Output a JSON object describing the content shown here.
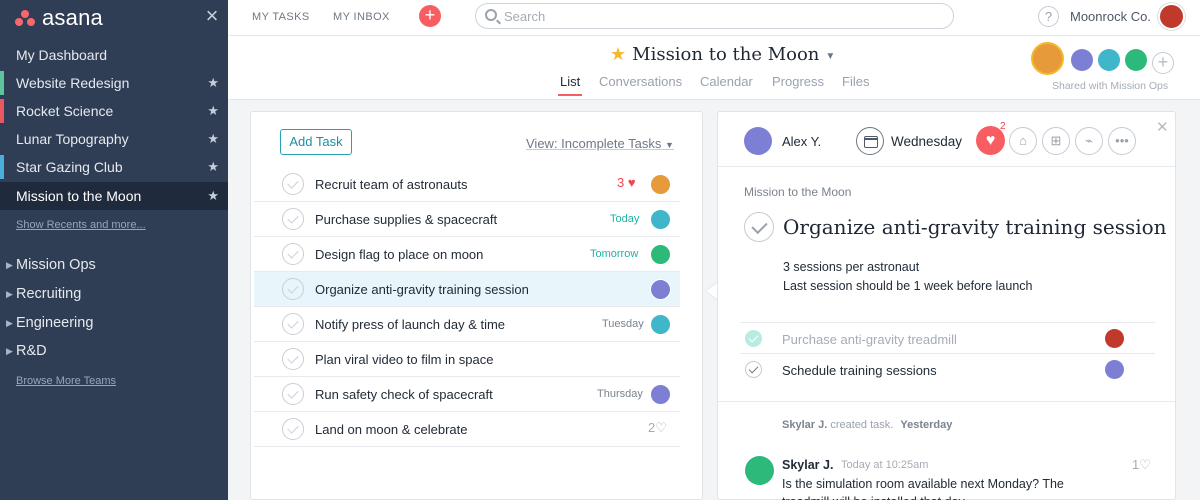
{
  "sidebar": {
    "brand": "asana",
    "items": [
      {
        "label": "My Dashboard",
        "star": false,
        "color": ""
      },
      {
        "label": "Website Redesign",
        "star": true,
        "color": "#5ec49d"
      },
      {
        "label": "Rocket Science",
        "star": true,
        "color": "#e8585e"
      },
      {
        "label": "Lunar Topography",
        "star": true,
        "color": ""
      },
      {
        "label": "Star Gazing Club",
        "star": true,
        "color": "#4ab0d9"
      },
      {
        "label": "Mission to the Moon",
        "star": true,
        "color": "",
        "active": true
      }
    ],
    "show_recents": "Show Recents and more...",
    "teams": [
      "Mission Ops",
      "Recruiting",
      "Engineering",
      "R&D"
    ],
    "browse_teams": "Browse More Teams"
  },
  "topbar": {
    "my_tasks": "MY TASKS",
    "my_inbox": "MY INBOX",
    "search_placeholder": "Search",
    "help": "?",
    "org": "Moonrock Co."
  },
  "project": {
    "title": "Mission to the Moon",
    "tabs": [
      "List",
      "Conversations",
      "Calendar",
      "Progress",
      "Files"
    ],
    "active_tab": "List",
    "shared_with": "Shared with Mission Ops"
  },
  "task_list": {
    "add_task": "Add Task",
    "view": "View: Incomplete Tasks",
    "tasks": [
      {
        "name": "Recruit team of astronauts",
        "due": "",
        "likes": "3",
        "liked": true,
        "avatar_color": "#e69a3a"
      },
      {
        "name": "Purchase supplies & spacecraft",
        "due": "Today",
        "due_color": "teal",
        "avatar_color": "#3fb6c9"
      },
      {
        "name": "Design flag to place on moon",
        "due": "Tomorrow",
        "due_color": "teal",
        "avatar_color": "#2cb97a"
      },
      {
        "name": "Organize anti-gravity training session",
        "due": "",
        "avatar_color": "#7d7fd4",
        "selected": true
      },
      {
        "name": "Notify press of launch day & time",
        "due": "Tuesday",
        "avatar_color": "#3fb6c9"
      },
      {
        "name": "Plan viral video to film in space",
        "due": ""
      },
      {
        "name": "Run safety check of spacecraft",
        "due": "Thursday",
        "avatar_color": "#7d7fd4"
      },
      {
        "name": "Land on moon & celebrate",
        "due": "",
        "likes": "2",
        "liked": false
      }
    ]
  },
  "detail": {
    "assignee": "Alex Y.",
    "due": "Wednesday",
    "heart_count": "2",
    "project": "Mission to the Moon",
    "title": "Organize anti-gravity training session",
    "desc_line1": "3 sessions per astronaut",
    "desc_line2": "Last session should be 1 week before launch",
    "subtasks": [
      {
        "name": "Purchase anti-gravity treadmill",
        "done": true,
        "avatar_color": "#c0392b"
      },
      {
        "name": "Schedule training sessions",
        "done": false,
        "avatar_color": "#7d7fd4"
      }
    ],
    "story_author": "Skylar J.",
    "story_action": "created task.",
    "story_time": "Yesterday",
    "comment_author": "Skylar J.",
    "comment_time": "Today at 10:25am",
    "comment_likes": "1",
    "comment_text": "Is the simulation room available next Monday? The treadmill will be installed that day."
  }
}
